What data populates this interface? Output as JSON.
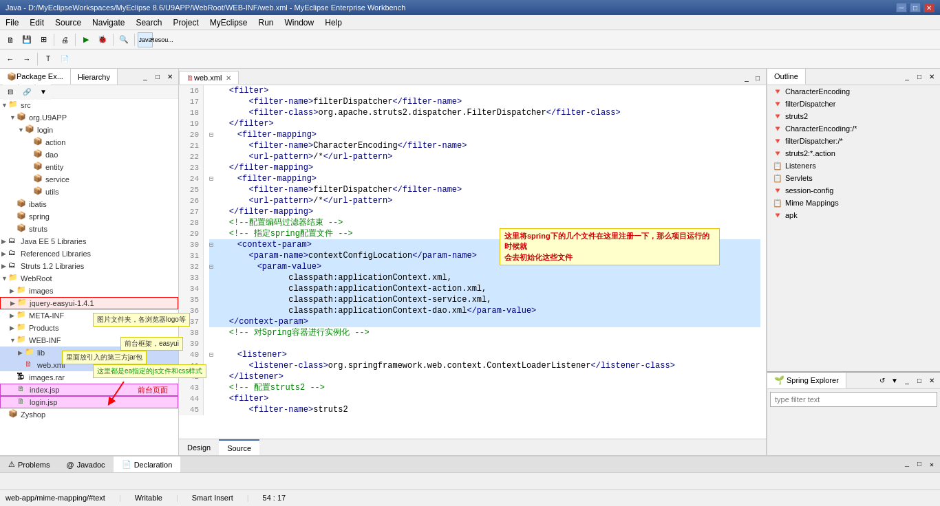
{
  "titlebar": {
    "title": "Java - D:/MyEclipseWorkspaces/MyEclipse 8.6/U9APP/WebRoot/WEB-INF/web.xml - MyEclipse Enterprise Workbench",
    "min": "─",
    "max": "□",
    "close": "✕"
  },
  "menubar": {
    "items": [
      "File",
      "Edit",
      "Source",
      "Navigate",
      "Search",
      "Project",
      "MyEclipse",
      "Run",
      "Window",
      "Help"
    ]
  },
  "left_panel": {
    "tabs": [
      {
        "label": "Package Ex...",
        "active": true
      },
      {
        "label": "Hierarchy",
        "active": false
      }
    ],
    "tree": [
      {
        "indent": 0,
        "arrow": "▼",
        "icon": "📁",
        "label": "src",
        "type": "folder"
      },
      {
        "indent": 1,
        "arrow": "▼",
        "icon": "📦",
        "label": "org.U9APP",
        "type": "package"
      },
      {
        "indent": 2,
        "arrow": "▼",
        "icon": "📦",
        "label": "login",
        "type": "package"
      },
      {
        "indent": 3,
        "arrow": "",
        "icon": "📦",
        "label": "action",
        "type": "package"
      },
      {
        "indent": 3,
        "arrow": "",
        "icon": "📦",
        "label": "dao",
        "type": "package"
      },
      {
        "indent": 3,
        "arrow": "",
        "icon": "📦",
        "label": "entity",
        "type": "package"
      },
      {
        "indent": 3,
        "arrow": "",
        "icon": "📦",
        "label": "service",
        "type": "package"
      },
      {
        "indent": 3,
        "arrow": "",
        "icon": "📦",
        "label": "utils",
        "type": "package"
      },
      {
        "indent": 1,
        "arrow": "",
        "icon": "📦",
        "label": "ibatis",
        "type": "package"
      },
      {
        "indent": 1,
        "arrow": "",
        "icon": "📦",
        "label": "spring",
        "type": "package"
      },
      {
        "indent": 1,
        "arrow": "",
        "icon": "📦",
        "label": "struts",
        "type": "package"
      },
      {
        "indent": 0,
        "arrow": "▶",
        "icon": "🗂",
        "label": "Java EE 5 Libraries",
        "type": "lib"
      },
      {
        "indent": 0,
        "arrow": "▶",
        "icon": "🗂",
        "label": "Referenced Libraries",
        "type": "lib"
      },
      {
        "indent": 0,
        "arrow": "▶",
        "icon": "🗂",
        "label": "Struts 1.2 Libraries",
        "type": "lib"
      },
      {
        "indent": 0,
        "arrow": "▼",
        "icon": "📁",
        "label": "WebRoot",
        "type": "folder"
      },
      {
        "indent": 1,
        "arrow": "▶",
        "icon": "📁",
        "label": "images",
        "type": "folder"
      },
      {
        "indent": 1,
        "arrow": "▶",
        "icon": "📁",
        "label": "jquery-easyui-1.4.1",
        "type": "folder",
        "highlighted": true
      },
      {
        "indent": 1,
        "arrow": "▶",
        "icon": "📁",
        "label": "META-INF",
        "type": "folder"
      },
      {
        "indent": 1,
        "arrow": "▶",
        "icon": "📁",
        "label": "Products",
        "type": "folder"
      },
      {
        "indent": 1,
        "arrow": "▼",
        "icon": "📁",
        "label": "WEB-INF",
        "type": "folder"
      },
      {
        "indent": 2,
        "arrow": "▶",
        "icon": "📁",
        "label": "lib",
        "type": "folder",
        "selected": true
      },
      {
        "indent": 2,
        "arrow": "",
        "icon": "🗎",
        "label": "web.xml",
        "type": "xml",
        "selected": true
      },
      {
        "indent": 1,
        "arrow": "",
        "icon": "🗜",
        "label": "images.rar",
        "type": "rar"
      },
      {
        "indent": 1,
        "arrow": "",
        "icon": "🗎",
        "label": "index.jsp",
        "type": "jsp",
        "highlighted2": true
      },
      {
        "indent": 1,
        "arrow": "",
        "icon": "🗎",
        "label": "login.jsp",
        "type": "jsp",
        "highlighted2": true
      },
      {
        "indent": 0,
        "arrow": "",
        "icon": "📦",
        "label": "Zyshop",
        "type": "package"
      }
    ],
    "annotation_images": "图片文件夹，各浏览器logo等",
    "annotation_easyui": "前台框架，easyui",
    "annotation_metainf": "里面放引入的第三方jar包",
    "annotation_lib": "这里都是ea指定的js文件和css样式",
    "annotation_frontend": "前台页面"
  },
  "editor": {
    "tabs": [
      {
        "label": "web.xml",
        "active": true,
        "modified": false
      }
    ],
    "lines": [
      {
        "num": 16,
        "code": "    <filter>"
      },
      {
        "num": 17,
        "code": "        <filter-name>filterDispatcher</filter-name>"
      },
      {
        "num": 18,
        "code": "        <filter-class>org.apache.struts2.dispatcher.FilterDispatcher</filter-class>"
      },
      {
        "num": 19,
        "code": "    </filter>"
      },
      {
        "num": 20,
        "code": "    <filter-mapping>",
        "fold": true
      },
      {
        "num": 21,
        "code": "        <filter-name>CharacterEncoding</filter-name>"
      },
      {
        "num": 22,
        "code": "        <url-pattern>/*</url-pattern>"
      },
      {
        "num": 23,
        "code": "    </filter-mapping>"
      },
      {
        "num": 24,
        "code": "    <filter-mapping>",
        "fold": true
      },
      {
        "num": 25,
        "code": "        <filter-name>filterDispatcher</filter-name>"
      },
      {
        "num": 26,
        "code": "        <url-pattern>/*</url-pattern>"
      },
      {
        "num": 27,
        "code": "    </filter-mapping>"
      },
      {
        "num": 28,
        "code": "    <!--配置编码过滤器结束 -->"
      },
      {
        "num": 29,
        "code": "    <!-- 指定spring配置文件 -->"
      },
      {
        "num": 30,
        "code": "    <context-param>",
        "fold": true
      },
      {
        "num": 31,
        "code": "        <param-name>contextConfigLocation</param-name>"
      },
      {
        "num": 32,
        "code": "        <param-value>",
        "fold": true
      },
      {
        "num": 33,
        "code": "                classpath:applicationContext.xml,"
      },
      {
        "num": 34,
        "code": "                classpath:applicationContext-action.xml,"
      },
      {
        "num": 35,
        "code": "                classpath:applicationContext-service.xml,"
      },
      {
        "num": 36,
        "code": "                classpath:applicationContext-dao.xml</param-value>"
      },
      {
        "num": 37,
        "code": "    </context-param>"
      },
      {
        "num": 38,
        "code": "    <!-- 对Spring容器进行实例化 -->"
      },
      {
        "num": 39,
        "code": ""
      },
      {
        "num": 40,
        "code": "    <listener>",
        "fold": true
      },
      {
        "num": 41,
        "code": "        <listener-class>org.springframework.web.context.ContextLoaderListener</listener-class>"
      },
      {
        "num": 42,
        "code": "    </listener>"
      },
      {
        "num": 43,
        "code": "    <!-- 配置struts2 -->"
      },
      {
        "num": 44,
        "code": "    <filter>"
      },
      {
        "num": 45,
        "code": "        <filter-name>struts2</filter-name>"
      }
    ],
    "annotation_spring": "这里将spring下的几个文件在这里注册一下，那么项目运行的时候就会去初始化这些文件",
    "bottom_tabs": [
      "Design",
      "Source"
    ]
  },
  "outline_panel": {
    "title": "Outline",
    "items": [
      {
        "icon": "🔻",
        "label": "CharacterEncoding"
      },
      {
        "icon": "🔻",
        "label": "filterDispatcher"
      },
      {
        "icon": "🔻",
        "label": "struts2"
      },
      {
        "icon": "🔻",
        "label": "CharacterEncoding:/*"
      },
      {
        "icon": "🔻",
        "label": "filterDispatcher:/*"
      },
      {
        "icon": "🔻",
        "label": "struts2:*.action"
      },
      {
        "icon": "📋",
        "label": "Listeners"
      },
      {
        "icon": "📋",
        "label": "Servlets"
      },
      {
        "icon": "🔻",
        "label": "session-config"
      },
      {
        "icon": "📋",
        "label": "Mime Mappings"
      },
      {
        "icon": "🔻",
        "label": "apk"
      }
    ]
  },
  "spring_explorer": {
    "title": "Spring Explorer",
    "search_placeholder": "type filter text"
  },
  "bottom_panels": {
    "tabs": [
      {
        "label": "Problems",
        "active": false
      },
      {
        "label": "Javadoc",
        "active": false
      },
      {
        "label": "Declaration",
        "active": true
      }
    ]
  },
  "statusbar": {
    "path": "web-app/mime-mapping/#text",
    "mode": "Writable",
    "insert": "Smart Insert",
    "position": "54 : 17"
  }
}
